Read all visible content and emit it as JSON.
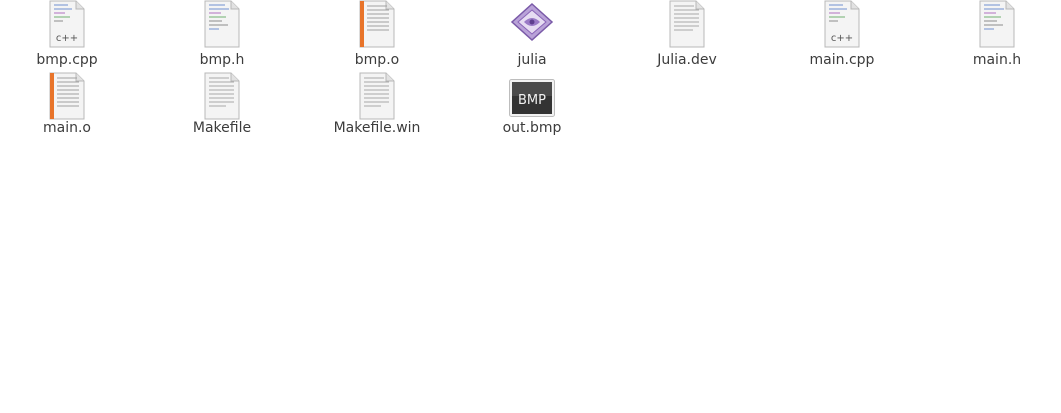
{
  "files": [
    {
      "name": "bmp.cpp",
      "icon": "cpp-source-icon"
    },
    {
      "name": "bmp.h",
      "icon": "c-header-icon"
    },
    {
      "name": "bmp.o",
      "icon": "object-file-icon"
    },
    {
      "name": "julia",
      "icon": "executable-icon"
    },
    {
      "name": "Julia.dev",
      "icon": "text-file-icon"
    },
    {
      "name": "main.cpp",
      "icon": "cpp-source-icon"
    },
    {
      "name": "main.h",
      "icon": "c-header-icon"
    },
    {
      "name": "main.o",
      "icon": "object-file-icon"
    },
    {
      "name": "Makefile",
      "icon": "text-file-icon"
    },
    {
      "name": "Makefile.win",
      "icon": "text-file-icon"
    },
    {
      "name": "out.bmp",
      "icon": "bmp-image-icon"
    }
  ],
  "icon_text": {
    "cpp": "c++",
    "bmp": "BMP"
  },
  "colors": {
    "paper": "#f4f4f4",
    "paper_border": "#b8b8b8",
    "object_stripe": "#e8742a",
    "exec_purple": "#8a64b8",
    "bmp_dark": "#333333"
  }
}
